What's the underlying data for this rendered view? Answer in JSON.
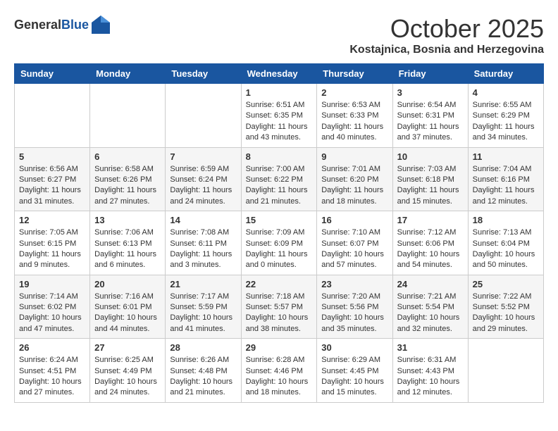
{
  "header": {
    "logo_general": "General",
    "logo_blue": "Blue",
    "month_title": "October 2025",
    "location": "Kostajnica, Bosnia and Herzegovina"
  },
  "days_of_week": [
    "Sunday",
    "Monday",
    "Tuesday",
    "Wednesday",
    "Thursday",
    "Friday",
    "Saturday"
  ],
  "weeks": [
    [
      {
        "day": "",
        "info": ""
      },
      {
        "day": "",
        "info": ""
      },
      {
        "day": "",
        "info": ""
      },
      {
        "day": "1",
        "info": "Sunrise: 6:51 AM\nSunset: 6:35 PM\nDaylight: 11 hours\nand 43 minutes."
      },
      {
        "day": "2",
        "info": "Sunrise: 6:53 AM\nSunset: 6:33 PM\nDaylight: 11 hours\nand 40 minutes."
      },
      {
        "day": "3",
        "info": "Sunrise: 6:54 AM\nSunset: 6:31 PM\nDaylight: 11 hours\nand 37 minutes."
      },
      {
        "day": "4",
        "info": "Sunrise: 6:55 AM\nSunset: 6:29 PM\nDaylight: 11 hours\nand 34 minutes."
      }
    ],
    [
      {
        "day": "5",
        "info": "Sunrise: 6:56 AM\nSunset: 6:27 PM\nDaylight: 11 hours\nand 31 minutes."
      },
      {
        "day": "6",
        "info": "Sunrise: 6:58 AM\nSunset: 6:26 PM\nDaylight: 11 hours\nand 27 minutes."
      },
      {
        "day": "7",
        "info": "Sunrise: 6:59 AM\nSunset: 6:24 PM\nDaylight: 11 hours\nand 24 minutes."
      },
      {
        "day": "8",
        "info": "Sunrise: 7:00 AM\nSunset: 6:22 PM\nDaylight: 11 hours\nand 21 minutes."
      },
      {
        "day": "9",
        "info": "Sunrise: 7:01 AM\nSunset: 6:20 PM\nDaylight: 11 hours\nand 18 minutes."
      },
      {
        "day": "10",
        "info": "Sunrise: 7:03 AM\nSunset: 6:18 PM\nDaylight: 11 hours\nand 15 minutes."
      },
      {
        "day": "11",
        "info": "Sunrise: 7:04 AM\nSunset: 6:16 PM\nDaylight: 11 hours\nand 12 minutes."
      }
    ],
    [
      {
        "day": "12",
        "info": "Sunrise: 7:05 AM\nSunset: 6:15 PM\nDaylight: 11 hours\nand 9 minutes."
      },
      {
        "day": "13",
        "info": "Sunrise: 7:06 AM\nSunset: 6:13 PM\nDaylight: 11 hours\nand 6 minutes."
      },
      {
        "day": "14",
        "info": "Sunrise: 7:08 AM\nSunset: 6:11 PM\nDaylight: 11 hours\nand 3 minutes."
      },
      {
        "day": "15",
        "info": "Sunrise: 7:09 AM\nSunset: 6:09 PM\nDaylight: 11 hours\nand 0 minutes."
      },
      {
        "day": "16",
        "info": "Sunrise: 7:10 AM\nSunset: 6:07 PM\nDaylight: 10 hours\nand 57 minutes."
      },
      {
        "day": "17",
        "info": "Sunrise: 7:12 AM\nSunset: 6:06 PM\nDaylight: 10 hours\nand 54 minutes."
      },
      {
        "day": "18",
        "info": "Sunrise: 7:13 AM\nSunset: 6:04 PM\nDaylight: 10 hours\nand 50 minutes."
      }
    ],
    [
      {
        "day": "19",
        "info": "Sunrise: 7:14 AM\nSunset: 6:02 PM\nDaylight: 10 hours\nand 47 minutes."
      },
      {
        "day": "20",
        "info": "Sunrise: 7:16 AM\nSunset: 6:01 PM\nDaylight: 10 hours\nand 44 minutes."
      },
      {
        "day": "21",
        "info": "Sunrise: 7:17 AM\nSunset: 5:59 PM\nDaylight: 10 hours\nand 41 minutes."
      },
      {
        "day": "22",
        "info": "Sunrise: 7:18 AM\nSunset: 5:57 PM\nDaylight: 10 hours\nand 38 minutes."
      },
      {
        "day": "23",
        "info": "Sunrise: 7:20 AM\nSunset: 5:56 PM\nDaylight: 10 hours\nand 35 minutes."
      },
      {
        "day": "24",
        "info": "Sunrise: 7:21 AM\nSunset: 5:54 PM\nDaylight: 10 hours\nand 32 minutes."
      },
      {
        "day": "25",
        "info": "Sunrise: 7:22 AM\nSunset: 5:52 PM\nDaylight: 10 hours\nand 29 minutes."
      }
    ],
    [
      {
        "day": "26",
        "info": "Sunrise: 6:24 AM\nSunset: 4:51 PM\nDaylight: 10 hours\nand 27 minutes."
      },
      {
        "day": "27",
        "info": "Sunrise: 6:25 AM\nSunset: 4:49 PM\nDaylight: 10 hours\nand 24 minutes."
      },
      {
        "day": "28",
        "info": "Sunrise: 6:26 AM\nSunset: 4:48 PM\nDaylight: 10 hours\nand 21 minutes."
      },
      {
        "day": "29",
        "info": "Sunrise: 6:28 AM\nSunset: 4:46 PM\nDaylight: 10 hours\nand 18 minutes."
      },
      {
        "day": "30",
        "info": "Sunrise: 6:29 AM\nSunset: 4:45 PM\nDaylight: 10 hours\nand 15 minutes."
      },
      {
        "day": "31",
        "info": "Sunrise: 6:31 AM\nSunset: 4:43 PM\nDaylight: 10 hours\nand 12 minutes."
      },
      {
        "day": "",
        "info": ""
      }
    ]
  ]
}
